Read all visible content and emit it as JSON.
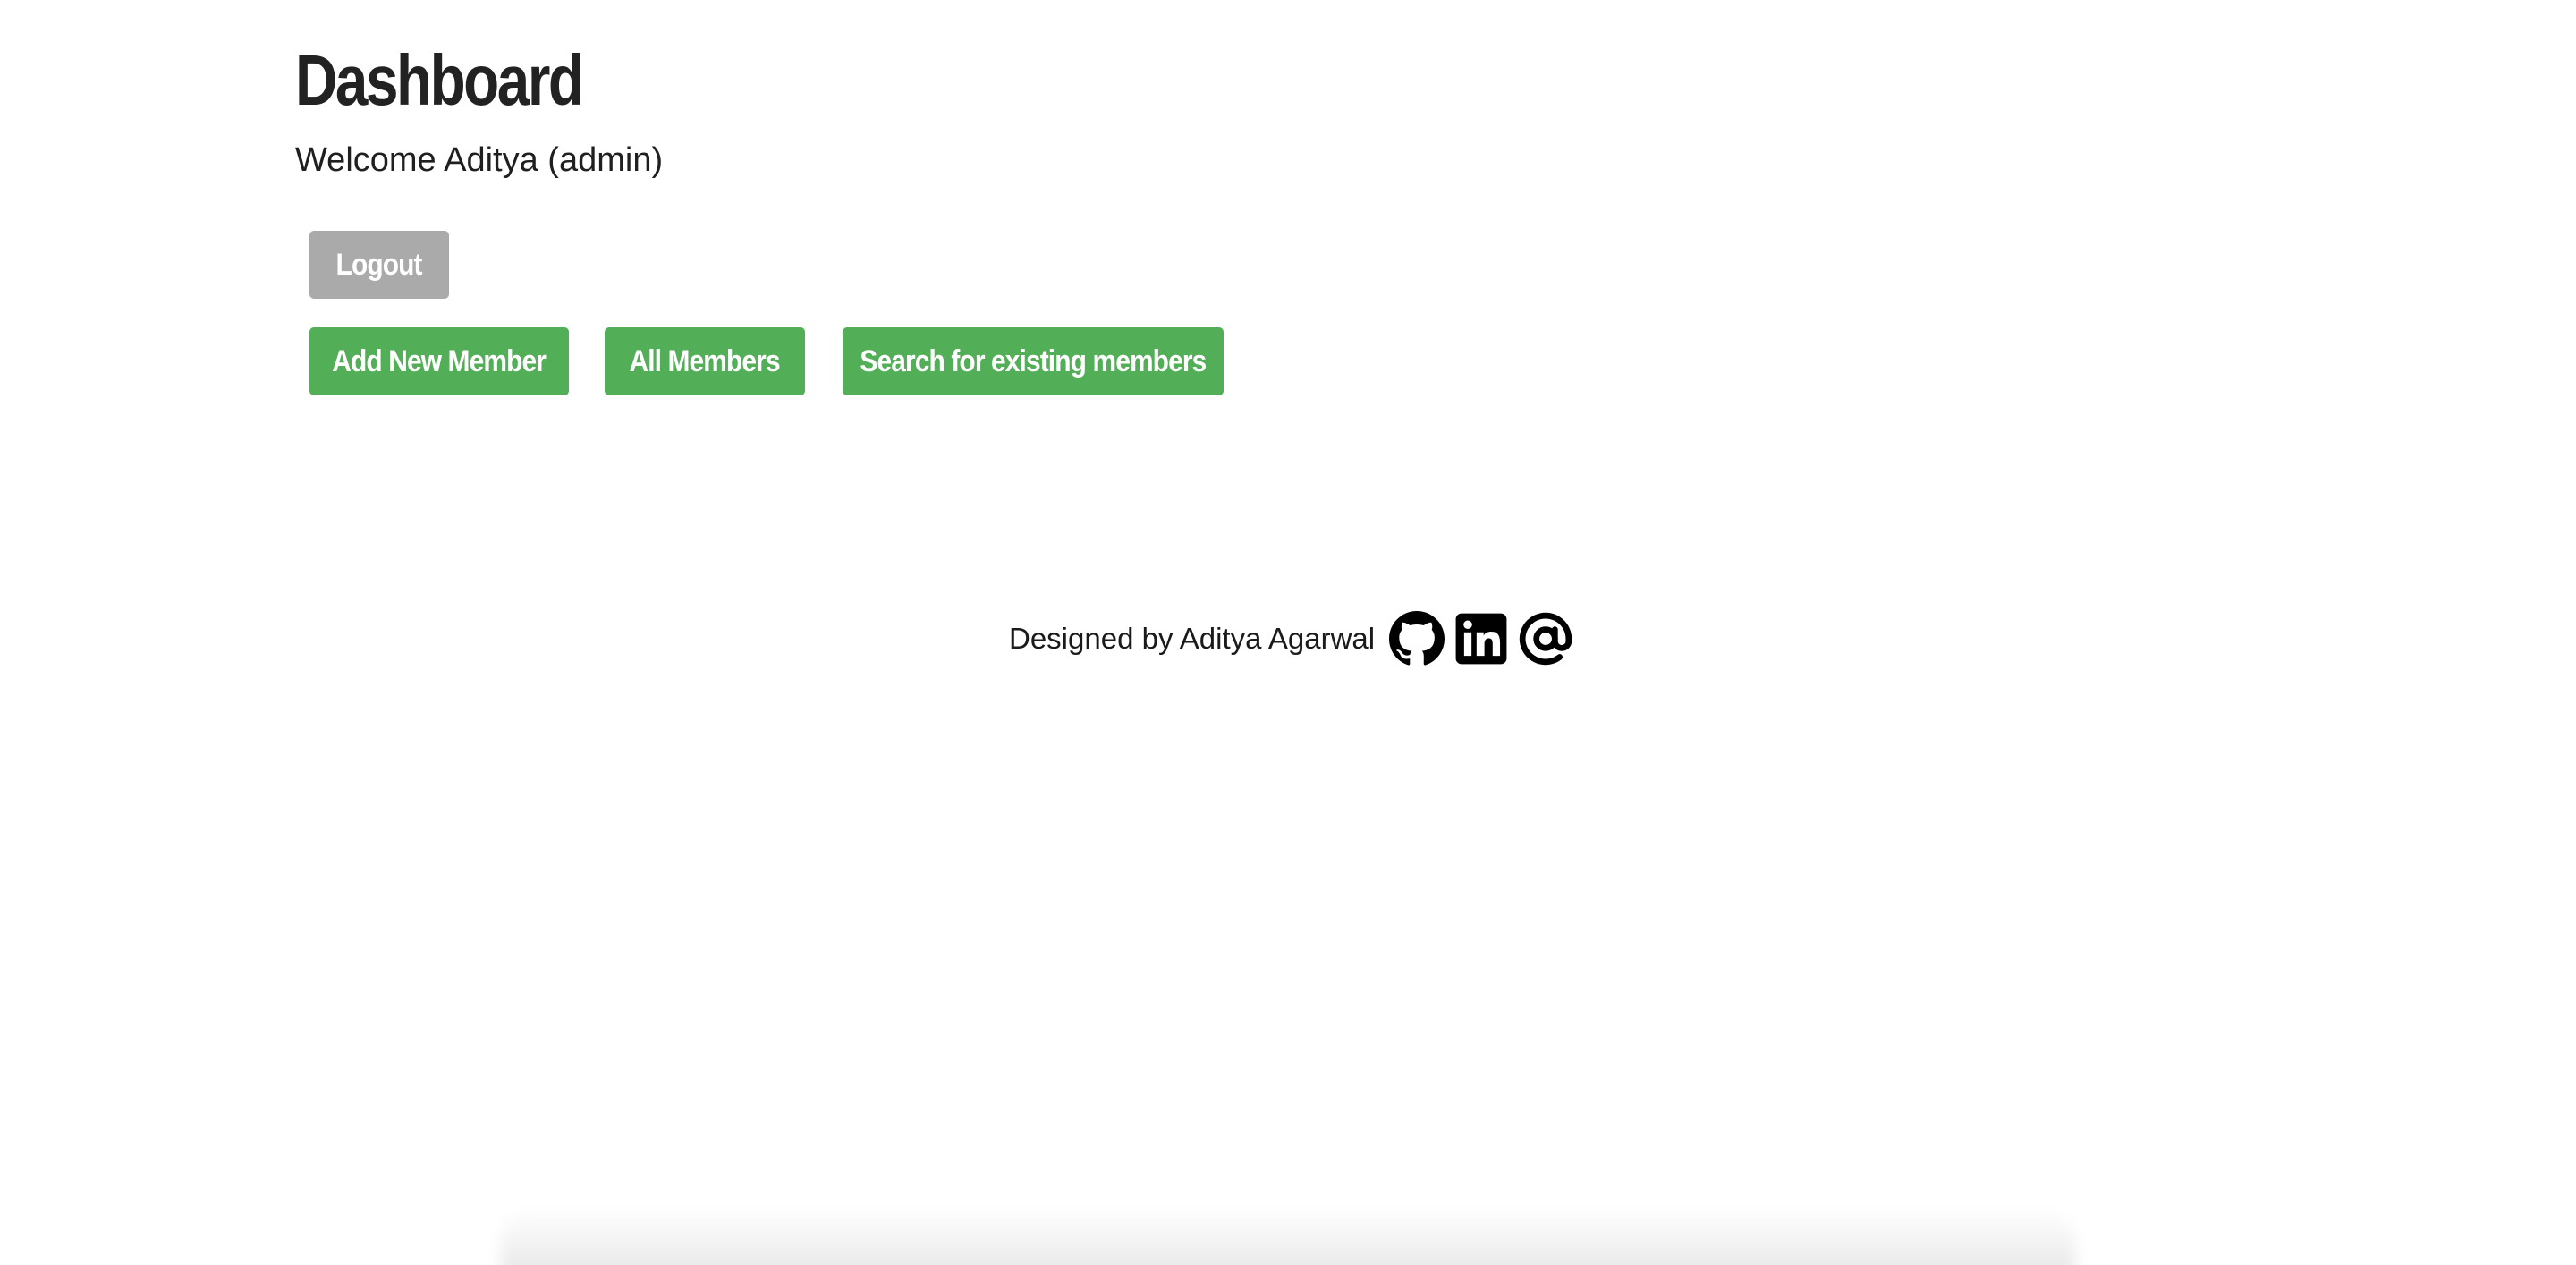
{
  "header": {
    "title": "Dashboard",
    "welcome": "Welcome Aditya (admin)"
  },
  "actions": {
    "logout_label": "Logout",
    "add_member_label": "Add New Member",
    "all_members_label": "All Members",
    "search_members_label": "Search for existing members"
  },
  "footer": {
    "credit": "Designed by Aditya Agarwal",
    "icons": [
      "github-icon",
      "linkedin-icon",
      "at-sign-icon"
    ]
  },
  "colors": {
    "primary_button": "#52ae57",
    "secondary_button": "#aaaaaa",
    "button_text": "#ffffff"
  }
}
